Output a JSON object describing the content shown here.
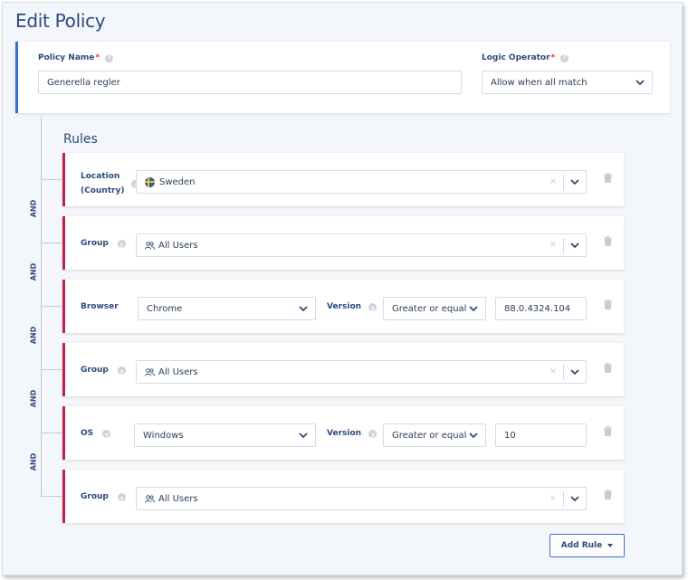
{
  "page": {
    "title": "Edit Policy"
  },
  "policy": {
    "name_label": "Policy Name",
    "required_mark": "*",
    "name_value": "Generella regler",
    "operator_label": "Logic Operator",
    "operator_value": "Allow when all match"
  },
  "rules": {
    "title": "Rules",
    "connector": "AND",
    "items": [
      {
        "type": "location",
        "label_line1": "Location",
        "label_line2": "(Country)",
        "value": "Sweden",
        "value_icon": "sweden-flag-icon"
      },
      {
        "type": "group",
        "label": "Group",
        "value": "All Users",
        "value_icon": "users-icon"
      },
      {
        "type": "browser",
        "label": "Browser",
        "value": "Chrome",
        "version_label": "Version",
        "operator": "Greater or equal",
        "version_value": "88.0.4324.104"
      },
      {
        "type": "group",
        "label": "Group",
        "value": "All Users",
        "value_icon": "users-icon"
      },
      {
        "type": "os",
        "label": "OS",
        "value": "Windows",
        "version_label": "Version",
        "operator": "Greater or equal",
        "version_value": "10"
      },
      {
        "type": "group",
        "label": "Group",
        "value": "All Users",
        "value_icon": "users-icon"
      }
    ],
    "clear_symbol": "×",
    "add_rule_label": "Add Rule"
  },
  "colors": {
    "accent": "#3b6fd6",
    "rule_border": "#c0204a",
    "title": "#2c4a7a",
    "background": "#f3f6fa"
  },
  "icons": [
    "help-icon",
    "chevron-down-icon",
    "trash-icon",
    "users-icon",
    "sweden-flag-icon",
    "caret-down-icon"
  ]
}
